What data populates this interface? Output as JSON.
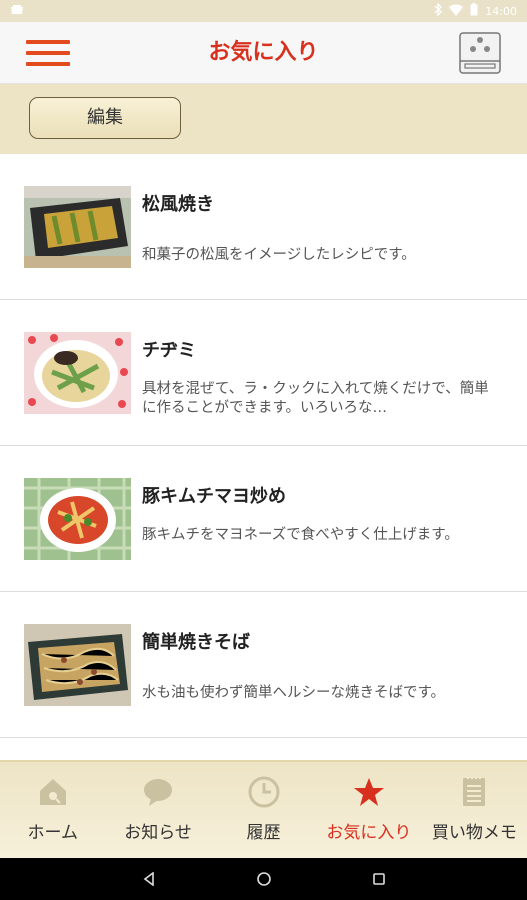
{
  "status_bar": {
    "time": "14:00",
    "icons": [
      "notification-icon",
      "bluetooth-icon",
      "wifi-icon",
      "battery-icon"
    ]
  },
  "header": {
    "title": "お気に入り",
    "menu_icon": "hamburger-menu-icon",
    "right_icon": "fridge-icon",
    "accent": "#d8301f"
  },
  "subbar": {
    "edit_label": "編集"
  },
  "recipes": [
    {
      "title": "松風焼き",
      "description": "和菓子の松風をイメージしたレシピです。"
    },
    {
      "title": "チヂミ",
      "description": "具材を混ぜて、ラ・クックに入れて焼くだけで、簡単に作ることができます。いろいろな…"
    },
    {
      "title": "豚キムチマヨ炒め",
      "description": "豚キムチをマヨネーズで食べやすく仕上げます。"
    },
    {
      "title": "簡単焼きそば",
      "description": "水も油も使わず簡単ヘルシーな焼きそばです。"
    }
  ],
  "tabs": [
    {
      "label": "ホーム",
      "icon": "home-icon"
    },
    {
      "label": "お知らせ",
      "icon": "speech-bubble-icon"
    },
    {
      "label": "履歴",
      "icon": "clock-icon"
    },
    {
      "label": "お気に入り",
      "icon": "star-icon",
      "active": true
    },
    {
      "label": "買い物メモ",
      "icon": "memo-icon"
    }
  ],
  "colors": {
    "accent_red": "#d8301f",
    "header_bg": "#f7f7f7",
    "subbar_bg": "#ede4c5",
    "tab_icon_inactive": "#c9c1a0"
  }
}
